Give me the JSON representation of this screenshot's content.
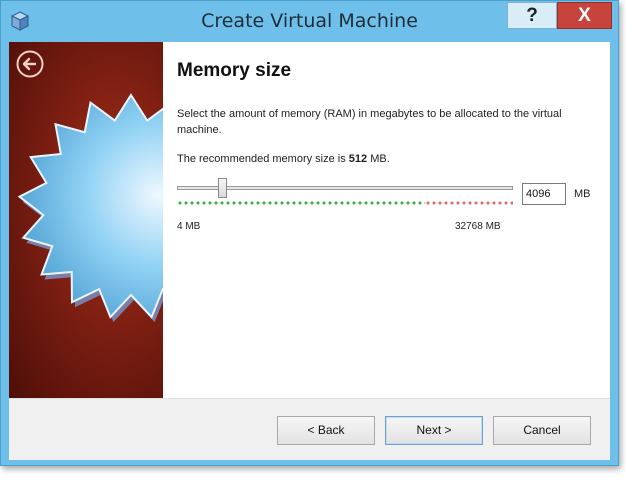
{
  "window": {
    "title": "Create Virtual Machine",
    "help_label": "?",
    "close_label": "X"
  },
  "page": {
    "heading": "Memory size",
    "description": "Select the amount of memory (RAM) in megabytes to be allocated to the virtual machine.",
    "recommended_prefix": "The recommended memory size is ",
    "recommended_value": "512",
    "recommended_suffix": " MB."
  },
  "memory": {
    "value": "4096",
    "unit": "MB",
    "min_label": "4 MB",
    "max_label": "32768 MB",
    "slider_fraction": 0.125
  },
  "buttons": {
    "back": "< Back",
    "next": "Next >",
    "cancel": "Cancel"
  },
  "colors": {
    "banner": "#7e1f12",
    "scale_ok": "#3db03f",
    "scale_warn": "#de6e6b",
    "title_bar": "#6ec0ea"
  },
  "icons": {
    "app": "virtualbox-cube-icon",
    "back": "back-arrow-circle-icon",
    "banner": "starburst-icon"
  }
}
